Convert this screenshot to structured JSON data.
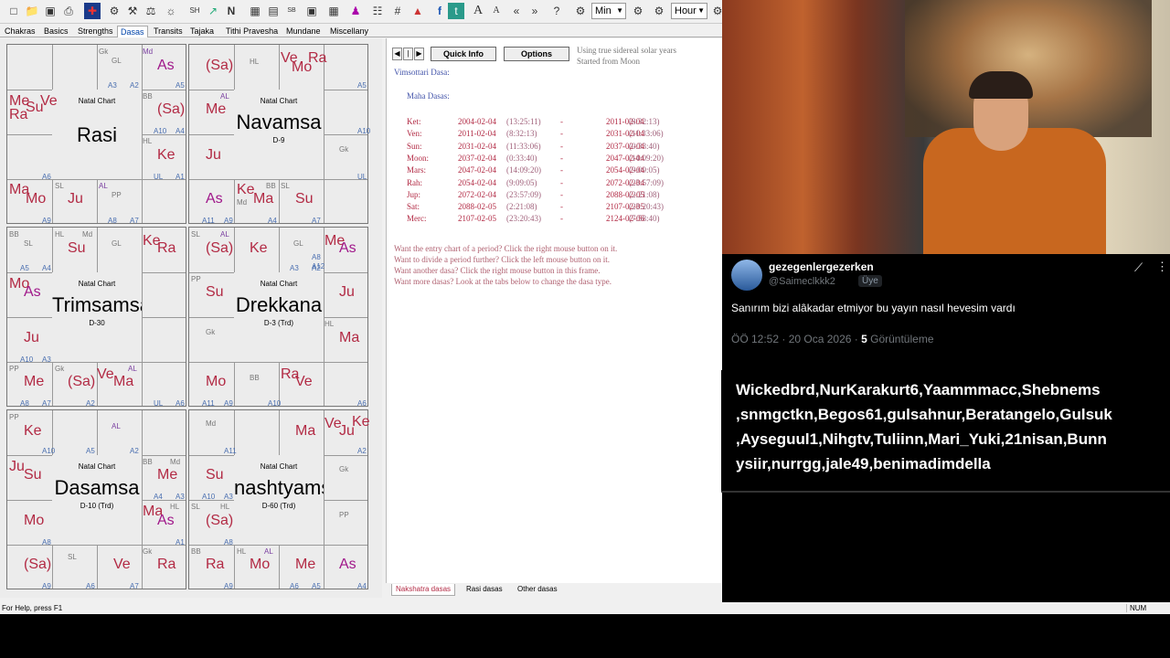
{
  "toolbar": {
    "min_select": "Min",
    "hour_select": "Hour"
  },
  "tabs": [
    "Chakras",
    "Basics",
    "Strengths",
    "Dasas",
    "Transits",
    "Tajaka",
    "Tithi Pravesha",
    "Mundane",
    "Miscellany"
  ],
  "charts": {
    "natal_chart_label": "Natal Chart",
    "rasi": {
      "name": "Rasi",
      "sub": ""
    },
    "navamsa": {
      "name": "Navamsa",
      "sub": "D-9"
    },
    "trimsamsa": {
      "name": "Trimsamsa",
      "sub": "D-30"
    },
    "drekkana": {
      "name": "Drekkana",
      "sub": "D-3 (Trd)"
    },
    "dasamsa": {
      "name": "Dasamsa",
      "sub": "D-10 (Trd)"
    },
    "shashtyamsa": {
      "name": "nashtyams",
      "sub": "D-60 (Trd)"
    }
  },
  "dasa": {
    "quick_info": "Quick Info",
    "options": "Options",
    "note1": "Using true sidereal solar years",
    "note2": "Started from Moon",
    "title": "Vimsottari Dasa:",
    "subtitle": "Maha Dasas:",
    "rows": [
      {
        "name": "Ket:",
        "start": "2004-02-04",
        "start_time": "(13:25:11)",
        "dash": "-",
        "end": "2011-02-04",
        "end_time": "(8:32:13)"
      },
      {
        "name": "Ven:",
        "start": "2011-02-04",
        "start_time": "(8:32:13)",
        "dash": "-",
        "end": "2031-02-04",
        "end_time": "(11:33:06)"
      },
      {
        "name": "Sun:",
        "start": "2031-02-04",
        "start_time": "(11:33:06)",
        "dash": "-",
        "end": "2037-02-04",
        "end_time": "(0:33:40)"
      },
      {
        "name": "Moon:",
        "start": "2037-02-04",
        "start_time": "(0:33:40)",
        "dash": "-",
        "end": "2047-02-04",
        "end_time": "(14:09:20)"
      },
      {
        "name": "Mars:",
        "start": "2047-02-04",
        "start_time": "(14:09:20)",
        "dash": "-",
        "end": "2054-02-04",
        "end_time": "(9:09:05)"
      },
      {
        "name": "Rah:",
        "start": "2054-02-04",
        "start_time": "(9:09:05)",
        "dash": "-",
        "end": "2072-02-04",
        "end_time": "(23:57:09)"
      },
      {
        "name": "Jup:",
        "start": "2072-02-04",
        "start_time": "(23:57:09)",
        "dash": "-",
        "end": "2088-02-05",
        "end_time": "(2:21:08)"
      },
      {
        "name": "Sat:",
        "start": "2088-02-05",
        "start_time": "(2:21:08)",
        "dash": "-",
        "end": "2107-02-05",
        "end_time": "(23:20:43)"
      },
      {
        "name": "Merc:",
        "start": "2107-02-05",
        "start_time": "(23:20:43)",
        "dash": "-",
        "end": "2124-02-06",
        "end_time": "(7:58:40)"
      }
    ],
    "help": [
      "Want the entry chart of a period? Click the right mouse button on it.",
      "Want to divide a period further? Click the left mouse button on it.",
      "Want another dasa? Click the right mouse button in this frame.",
      "Want more dasas? Look at the tabs below to change the dasa type."
    ],
    "bottom_tabs": [
      "Nakshatra dasas",
      "Rasi dasas",
      "Other dasas"
    ]
  },
  "status": {
    "help": "For Help, press F1",
    "num": "NUM"
  },
  "tweet": {
    "display_name": "gezegenlergezerken",
    "handle": "@Saimeclkkk2",
    "badge": "Üye",
    "text": "Sanırım bizi alâkadar etmiyor bu yayın nasıl hevesim vardı",
    "time": "ÖÖ 12:52 · 20 Oca 2026 ·",
    "views_count": "5",
    "views_label": "Görüntüleme"
  },
  "overlay_names": "Wickedbrd,NurKarakurt6,Yaammmacc,Shebnems ,snmgctkn,Begos61,gulsahnur,Beratangelo,Gulsuk ,Ayseguul1,Nihgtv,Tuliinn,Mari_Yuki,21nisan,Bunn ysiir,nurrgg,jale49,benimadimdella",
  "colors": {
    "planet": "#b22a44",
    "special": "#7a3fa0",
    "active_tab": "#0044aa"
  }
}
